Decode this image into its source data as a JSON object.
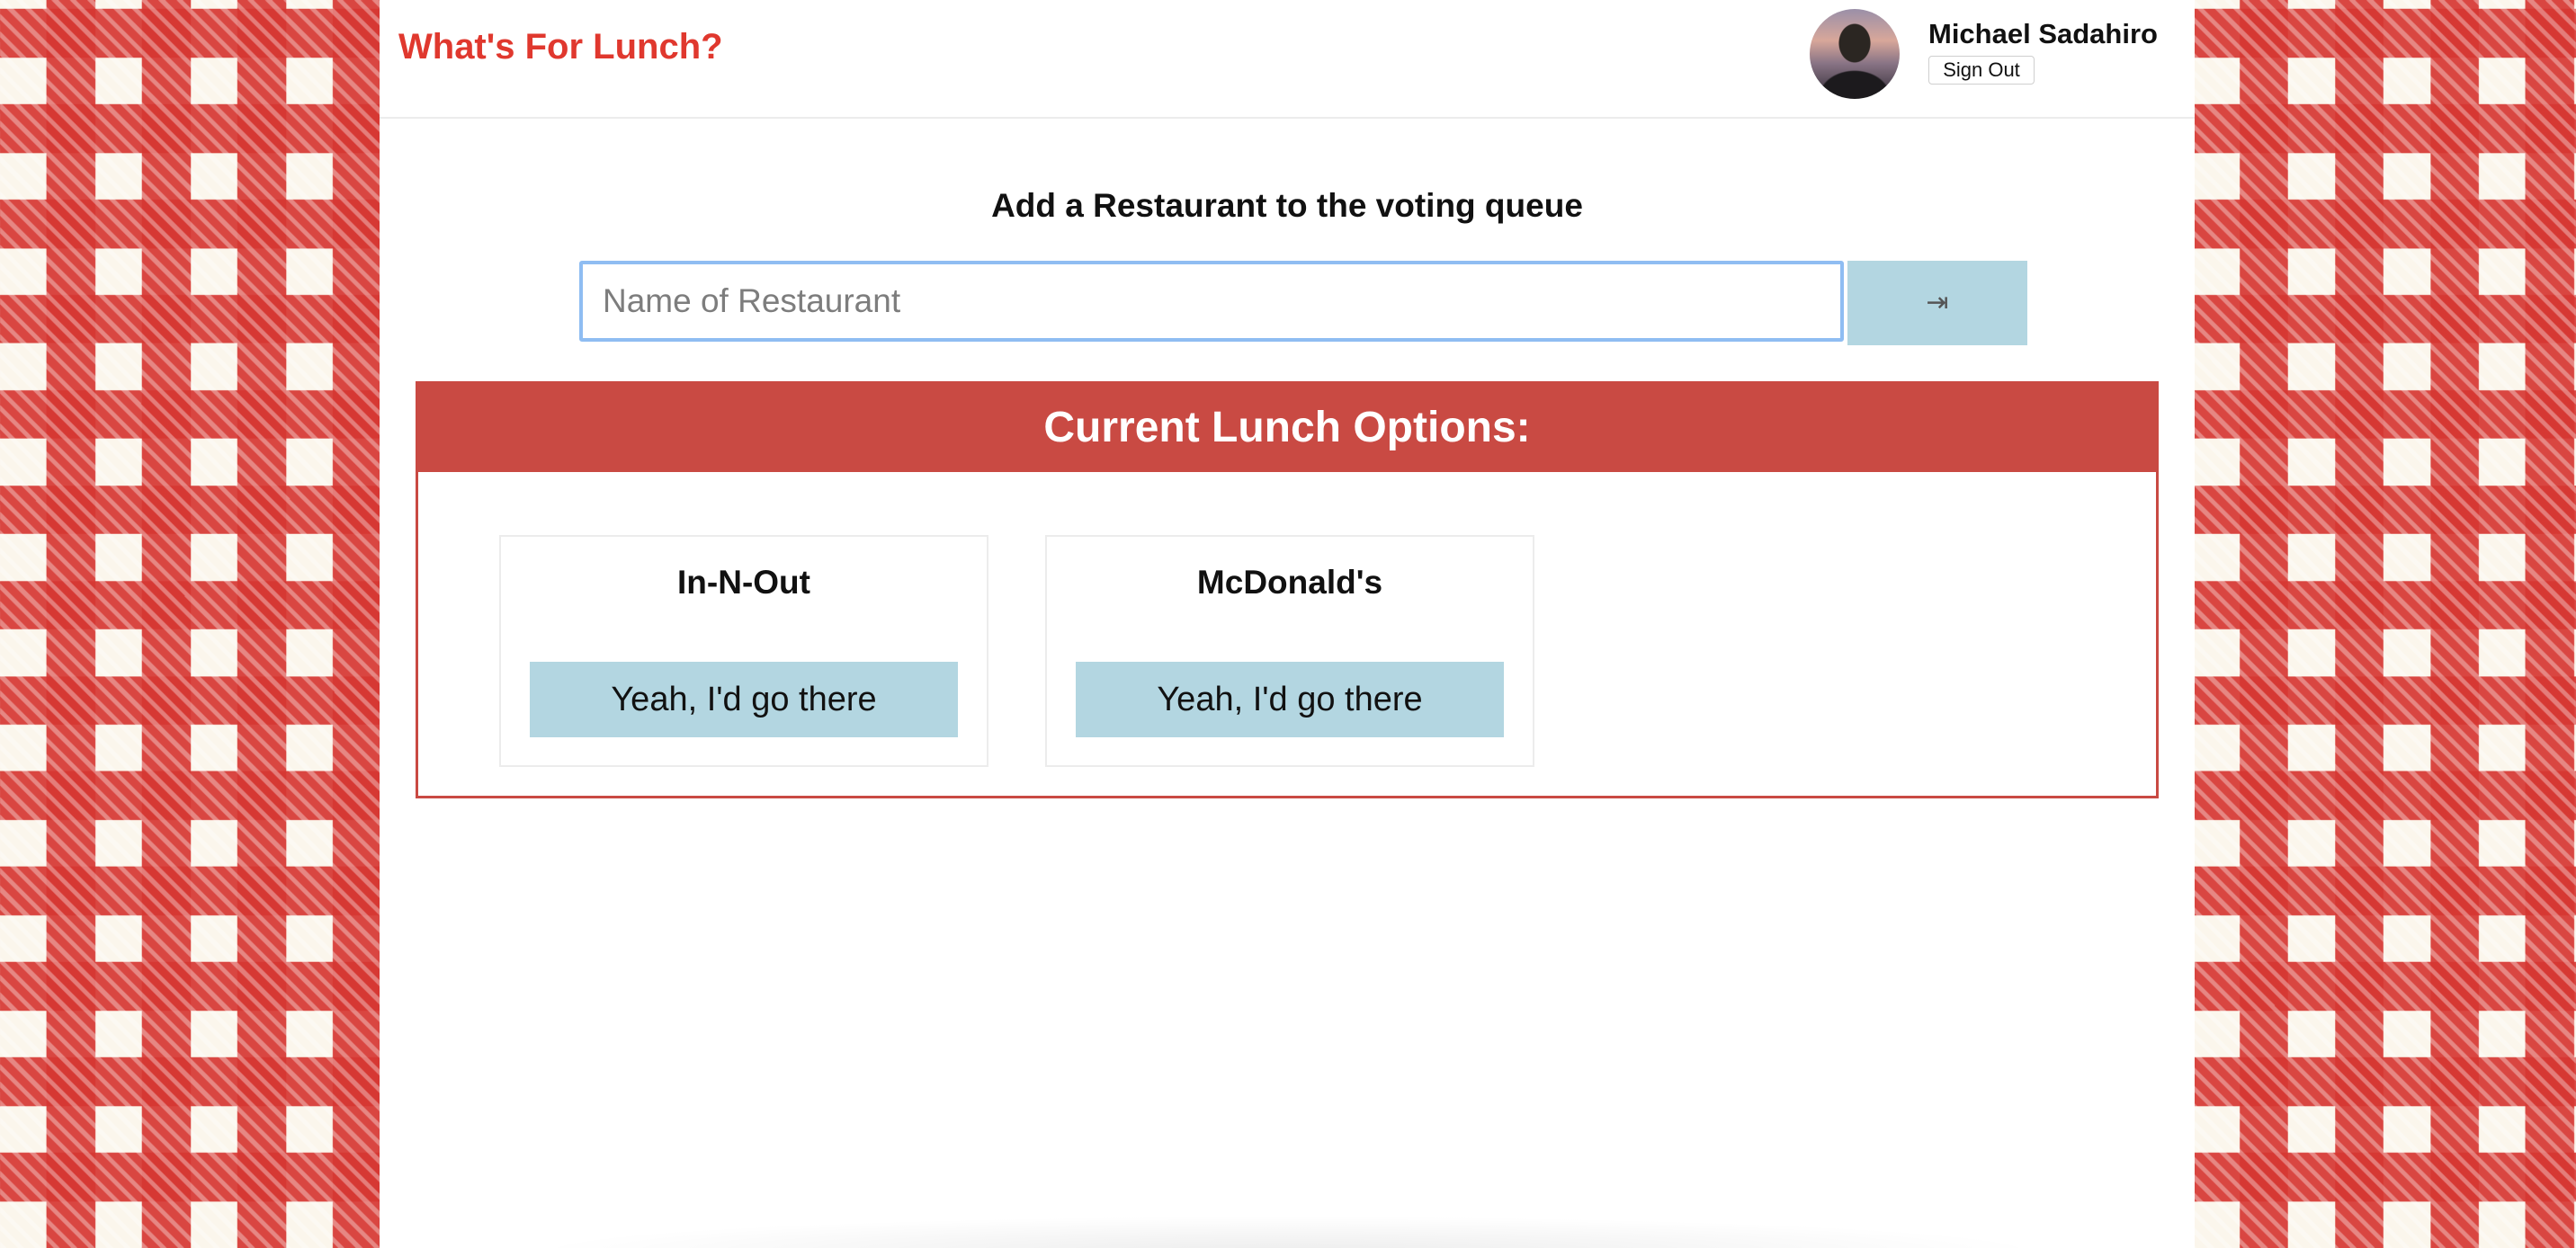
{
  "app": {
    "title": "What's For Lunch?"
  },
  "user": {
    "name": "Michael Sadahiro",
    "sign_out_label": "Sign Out",
    "avatar_icon": "avatar"
  },
  "add_restaurant": {
    "heading": "Add a Restaurant to the voting queue",
    "placeholder": "Name of Restaurant",
    "value": "",
    "submit_icon": "⇥"
  },
  "options": {
    "heading": "Current Lunch Options:",
    "items": [
      {
        "name": "In-N-Out",
        "vote_label": "Yeah, I'd go there"
      },
      {
        "name": "McDonald's",
        "vote_label": "Yeah, I'd go there"
      }
    ]
  },
  "colors": {
    "accent_red": "#e0382e",
    "panel_red": "#c94a43",
    "button_blue": "#b3d6e1",
    "focus_blue": "#8fbdf2"
  }
}
